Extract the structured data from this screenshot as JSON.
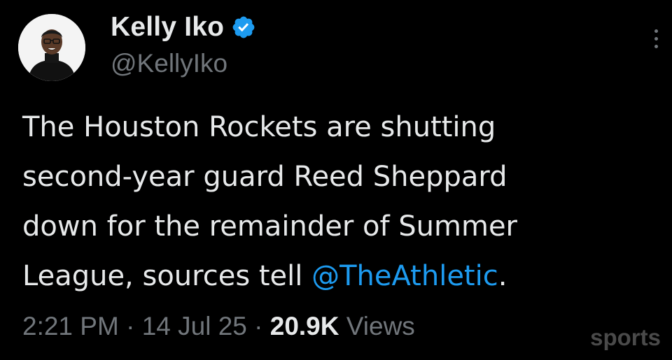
{
  "author": {
    "display_name": "Kelly Iko",
    "handle": "@KellyIko",
    "verified": true,
    "verified_color": "#1d9bf0",
    "avatar_icon": "profile-photo"
  },
  "tweet": {
    "lines": [
      "The Houston Rockets are shutting",
      "second-year guard Reed Sheppard",
      "down for the remainder of Summer",
      "League, sources tell "
    ],
    "mention": "@TheAthletic",
    "trailing": "."
  },
  "meta": {
    "time": "2:21 PM",
    "sep1": " · ",
    "date": "14 Jul 25",
    "sep2": " · ",
    "views_count": "20.9K",
    "views_label": " Views"
  },
  "more_icon": "more-vertical-icon",
  "watermark": "sports",
  "colors": {
    "background": "#000000",
    "text": "#e7e9ea",
    "secondary": "#71767b",
    "link": "#1d9bf0"
  }
}
